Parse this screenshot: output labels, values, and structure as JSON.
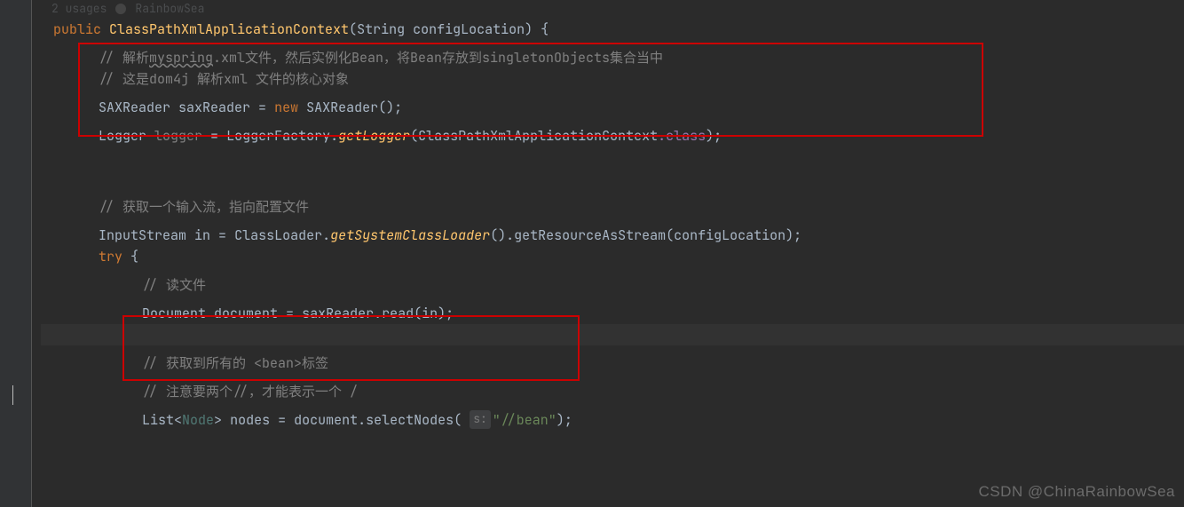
{
  "hints": {
    "usages": "2 usages",
    "author": "RainbowSea"
  },
  "code": {
    "l1": {
      "public": "public",
      "method": "ClassPathXmlApplicationContext",
      "p_type": "String",
      "p_name": "configLocation",
      "brace": ") {"
    },
    "l2": "// 解析",
    "l2_wave": "myspring",
    "l2_rest": ".xml文件，然后实例化Bean，将Bean存放到singletonObjects集合当中",
    "l3": "// 这是dom4j 解析xml 文件的核心对象",
    "l4": {
      "type": "SAXReader",
      "name": "saxReader",
      "eq": " = ",
      "new": "new",
      "ctor": "SAXReader",
      "tail": "();"
    },
    "l5": {
      "type": "Logger",
      "name": "logger",
      "eq": " = ",
      "cls": "LoggerFactory",
      "dot": ".",
      "m": "getLogger",
      "open": "(",
      "arg": "ClassPathXmlApplicationContext",
      "field": ".class",
      "close": ");"
    },
    "l6": "// 获取一个输入流，指向配置文件",
    "l7": {
      "type": "InputStream",
      "name": "in",
      "eq": " = ",
      "cls": "ClassLoader",
      "dot": ".",
      "m1": "getSystemClassLoader",
      "mid": "().",
      "m2": "getResourceAsStream",
      "open": "(",
      "arg": "configLocation",
      "close": ");"
    },
    "l8": {
      "try": "try",
      "brace": " {"
    },
    "l9": "// 读文件",
    "l10": {
      "type": "Document",
      "name": "document",
      "eq": " = ",
      "obj": "saxReader",
      "dot": ".",
      "m": "read",
      "open": "(",
      "arg": "in",
      "close": ");"
    },
    "l11": "// 获取到所有的 <bean>标签",
    "l12": "// 注意要两个//，才能表示一个 /",
    "l13": {
      "type": "List",
      "lt": "<",
      "gen": "Node",
      "gt": ">",
      "name": "nodes",
      "eq": " = ",
      "obj": "document",
      "dot": ".",
      "m": "selectNodes",
      "open": "(",
      "hint": "s:",
      "str": "\"//bean\"",
      "close": ");"
    }
  },
  "watermark": "CSDN @ChinaRainbowSea"
}
